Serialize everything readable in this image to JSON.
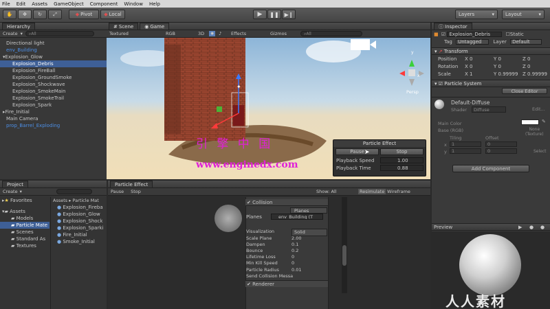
{
  "menu": [
    "File",
    "Edit",
    "Assets",
    "GameObject",
    "Component",
    "Window",
    "Help"
  ],
  "toolbar": {
    "pivot_label": "Pivot",
    "local_label": "Local",
    "layers_label": "Layers",
    "layout_label": "Layout"
  },
  "hierarchy": {
    "tab_label": "Hierarchy",
    "create_label": "Create",
    "search_placeholder": "All",
    "items": [
      {
        "label": "Directional light",
        "style": "normal"
      },
      {
        "label": "env_Building",
        "style": "blue"
      },
      {
        "label": "Explosion_Glow",
        "style": "normal"
      },
      {
        "label": "Explosion_Debris",
        "style": "selected"
      },
      {
        "label": "Explosion_FireBall",
        "style": "normal"
      },
      {
        "label": "Explosion_GroundSmoke",
        "style": "normal"
      },
      {
        "label": "Explosion_Shockwave",
        "style": "normal"
      },
      {
        "label": "Explosion_SmokeMain",
        "style": "normal"
      },
      {
        "label": "Explosion_SmokeTrail",
        "style": "normal"
      },
      {
        "label": "Explosion_Spark",
        "style": "normal"
      },
      {
        "label": "Fire_Initial",
        "style": "normal"
      },
      {
        "label": "Main Camera",
        "style": "normal"
      },
      {
        "label": "prop_Barrel_Exploding",
        "style": "blue"
      }
    ]
  },
  "scene": {
    "tab_scene": "Scene",
    "tab_game": "Game",
    "textured_label": "Textured",
    "rgb_label": "RGB",
    "mode_3d": "3D",
    "effects_label": "Effects",
    "gizmos_label": "Gizmos",
    "search_placeholder": "All",
    "persp_label": "Persp",
    "watermark_cn": "引 擎 中 国",
    "watermark_url": "www.enginedx.com",
    "particle_effect": {
      "title": "Particle Effect",
      "pause_label": "Pause",
      "stop_label": "Stop",
      "playback_speed_label": "Playback Speed",
      "playback_speed_value": "1.00",
      "playback_time_label": "Playback Time",
      "playback_time_value": "0.88"
    }
  },
  "project": {
    "tab_label": "Project",
    "create_label": "Create",
    "favorites_label": "Favorites",
    "assets_label": "Assets",
    "tree": [
      "Models",
      "Particle Mate",
      "Scenes",
      "Standard As",
      "Textures"
    ],
    "breadcrumb": "Assets ▸ Particle Mat",
    "files": [
      "Explosion_Fireba",
      "Explosion_Glow",
      "Explosion_Shock",
      "Explosion_Sparki",
      "Fire_Initial",
      "Smoke_Initial"
    ]
  },
  "particle_panel": {
    "tab_label": "Particle Effect",
    "pause_label": "Pause",
    "stop_label": "Stop",
    "show_all_label": "Show: All",
    "resimulate_label": "Resimulate",
    "wireframe_label": "Wireframe",
    "collision_header": "Collision",
    "planes_dropdown": "Planes",
    "planes_label": "Planes",
    "planes_value": "env_Building (T",
    "props": [
      {
        "label": "Visualization",
        "value": "Solid"
      },
      {
        "label": "Scale Plane",
        "value": "2.00"
      },
      {
        "label": "Dampen",
        "value": "0.1"
      },
      {
        "label": "Bounce",
        "value": "0.2"
      },
      {
        "label": "Lifetime Loss",
        "value": "0"
      },
      {
        "label": "Min Kill Speed",
        "value": "0"
      },
      {
        "label": "Particle Radius",
        "value": "0.01"
      },
      {
        "label": "Send Collision Messa",
        "value": ""
      }
    ],
    "renderer_header": "Renderer"
  },
  "inspector": {
    "tab_label": "Inspector",
    "object_name": "Explosion_Debris",
    "static_label": "Static",
    "tag_label": "Tag",
    "tag_value": "Untagged",
    "layer_label": "Layer",
    "layer_value": "Default",
    "transform_header": "Transform",
    "position_label": "Position",
    "rotation_label": "Rotation",
    "scale_label": "Scale",
    "position": {
      "x": "0",
      "y": "0",
      "z": "0"
    },
    "rotation": {
      "x": "0",
      "y": "0",
      "z": "0"
    },
    "scale": {
      "x": "1",
      "y": "0.99999",
      "z": "0.99999"
    },
    "particle_system_header": "Particle System",
    "close_editor_label": "Close Editor",
    "material_name": "Default-Diffuse",
    "shader_label": "Shader",
    "shader_value": "Diffuse",
    "edit_label": "Edit...",
    "main_color_label": "Main Color",
    "base_rgb_label": "Base (RGB)",
    "tiling_label": "Tiling",
    "offset_label": "Offset",
    "x_label": "x",
    "y_label": "y",
    "tiling_x": "1",
    "tiling_y": "1",
    "offset_x": "0",
    "offset_y": "0",
    "none_label": "None",
    "texture_label": "(Texture)",
    "select_label": "Select",
    "add_component_label": "Add Component",
    "preview_label": "Preview",
    "watermark": "人人素材"
  },
  "colors": {
    "selection": "#3e5f96",
    "prefab_blue": "#4d8fe6",
    "watermark_magenta": "#e020d8"
  }
}
